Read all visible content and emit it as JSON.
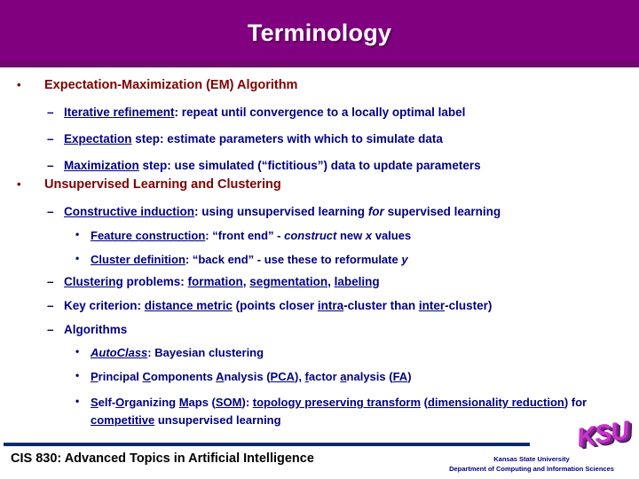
{
  "slide": {
    "title": "Terminology",
    "title_band_color": "#800080",
    "heading_color": "#800000",
    "body_color": "#000080"
  },
  "content": {
    "section1": {
      "heading": "Expectation-Maximization (EM) Algorithm",
      "bullet_marker": "•",
      "items": [
        {
          "marker": "–",
          "parts": [
            {
              "text": "Iterative refinement",
              "underline": true,
              "italic": false
            },
            {
              "text": ": repeat until convergence to a locally optimal label",
              "underline": false,
              "italic": false
            }
          ]
        },
        {
          "marker": "–",
          "parts": [
            {
              "text": "Expectation",
              "underline": true,
              "italic": false
            },
            {
              "text": " step: estimate parameters with which to simulate data",
              "underline": false,
              "italic": false
            }
          ]
        },
        {
          "marker": "–",
          "parts": [
            {
              "text": "Maximization",
              "underline": true,
              "italic": false
            },
            {
              "text": " step: use simulated (“fictitious”) data to update parameters",
              "underline": false,
              "italic": false
            }
          ]
        }
      ]
    },
    "section2": {
      "heading": "Unsupervised Learning and Clustering",
      "bullet_marker": "•",
      "items": [
        {
          "marker": "–",
          "parts": [
            {
              "text": "Constructive induction",
              "underline": true,
              "italic": false
            },
            {
              "text": ": using unsupervised learning ",
              "underline": false,
              "italic": false
            },
            {
              "text": "for",
              "underline": false,
              "italic": true
            },
            {
              "text": " supervised learning",
              "underline": false,
              "italic": false
            }
          ]
        },
        {
          "marker": "•",
          "parts": [
            {
              "text": "Feature construction",
              "underline": true,
              "italic": false
            },
            {
              "text": ": “front end” - ",
              "underline": false,
              "italic": false
            },
            {
              "text": "construct",
              "underline": false,
              "italic": true
            },
            {
              "text": " new ",
              "underline": false,
              "italic": false
            },
            {
              "text": "x",
              "underline": false,
              "italic": true
            },
            {
              "text": " values",
              "underline": false,
              "italic": false
            }
          ]
        },
        {
          "marker": "•",
          "parts": [
            {
              "text": "Cluster definition",
              "underline": true,
              "italic": false
            },
            {
              "text": ": “back end” - use these to reformulate ",
              "underline": false,
              "italic": false
            },
            {
              "text": "y",
              "underline": false,
              "italic": true
            }
          ]
        },
        {
          "marker": "–",
          "parts": [
            {
              "text": "Clustering",
              "underline": true,
              "italic": false
            },
            {
              "text": " problems: ",
              "underline": false,
              "italic": false
            },
            {
              "text": "formation",
              "underline": true,
              "italic": false
            },
            {
              "text": ", ",
              "underline": false,
              "italic": false
            },
            {
              "text": "segmentation",
              "underline": true,
              "italic": false
            },
            {
              "text": ", ",
              "underline": false,
              "italic": false
            },
            {
              "text": "labeling",
              "underline": true,
              "italic": false
            }
          ]
        },
        {
          "marker": "–",
          "parts": [
            {
              "text": "Key criterion: ",
              "underline": false,
              "italic": false
            },
            {
              "text": "distance metric",
              "underline": true,
              "italic": false
            },
            {
              "text": " (points closer ",
              "underline": false,
              "italic": false
            },
            {
              "text": "intra",
              "underline": true,
              "italic": false
            },
            {
              "text": "-cluster than ",
              "underline": false,
              "italic": false
            },
            {
              "text": "inter",
              "underline": true,
              "italic": false
            },
            {
              "text": "-cluster)",
              "underline": false,
              "italic": false
            }
          ]
        },
        {
          "marker": "–",
          "parts": [
            {
              "text": "Algorithms",
              "underline": false,
              "italic": false
            }
          ]
        },
        {
          "marker": "•",
          "parts": [
            {
              "text": "AutoClass",
              "underline": true,
              "italic": true
            },
            {
              "text": ": Bayesian clustering",
              "underline": false,
              "italic": false
            }
          ]
        },
        {
          "marker": "•",
          "parts": [
            {
              "text": "P",
              "underline": true,
              "italic": false
            },
            {
              "text": "rincipal ",
              "underline": false,
              "italic": false
            },
            {
              "text": "C",
              "underline": true,
              "italic": false
            },
            {
              "text": "omponents ",
              "underline": false,
              "italic": false
            },
            {
              "text": "A",
              "underline": true,
              "italic": false
            },
            {
              "text": "nalysis (",
              "underline": false,
              "italic": false
            },
            {
              "text": "PCA",
              "underline": true,
              "italic": false
            },
            {
              "text": "), ",
              "underline": false,
              "italic": false
            },
            {
              "text": "f",
              "underline": true,
              "italic": false
            },
            {
              "text": "actor ",
              "underline": false,
              "italic": false
            },
            {
              "text": "a",
              "underline": true,
              "italic": false
            },
            {
              "text": "nalysis (",
              "underline": false,
              "italic": false
            },
            {
              "text": "FA",
              "underline": true,
              "italic": false
            },
            {
              "text": ")",
              "underline": false,
              "italic": false
            }
          ]
        },
        {
          "marker": "•",
          "wrap": true,
          "parts": [
            {
              "text": "S",
              "underline": true,
              "italic": false
            },
            {
              "text": "elf-",
              "underline": false,
              "italic": false
            },
            {
              "text": "O",
              "underline": true,
              "italic": false
            },
            {
              "text": "rganizing ",
              "underline": false,
              "italic": false
            },
            {
              "text": "M",
              "underline": true,
              "italic": false
            },
            {
              "text": "aps (",
              "underline": false,
              "italic": false
            },
            {
              "text": "SOM",
              "underline": true,
              "italic": false
            },
            {
              "text": "): ",
              "underline": false,
              "italic": false
            },
            {
              "text": "topology preserving transform",
              "underline": true,
              "italic": false
            },
            {
              "text": " (",
              "underline": false,
              "italic": false
            },
            {
              "text": "dimensionality reduction",
              "underline": true,
              "italic": false
            },
            {
              "text": ") for ",
              "underline": false,
              "italic": false
            },
            {
              "text": "competitive",
              "underline": true,
              "italic": false
            },
            {
              "text": " unsupervised learning",
              "underline": false,
              "italic": false
            }
          ]
        }
      ]
    }
  },
  "footer": {
    "course": "CIS 830: Advanced Topics in Artificial Intelligence",
    "university": "Kansas State University",
    "department": "Department of Computing and Information Sciences",
    "logo_text": "KSU"
  }
}
